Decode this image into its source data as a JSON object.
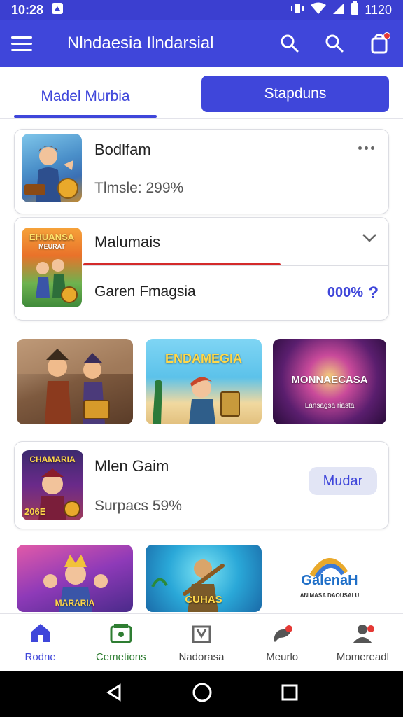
{
  "status_bar": {
    "time": "10:28",
    "right_time": "1120"
  },
  "app_bar": {
    "title": "Nlndaesia Ilndarsial"
  },
  "tabs": {
    "left": "Madel Murbia",
    "right": "Stapduns"
  },
  "cards": [
    {
      "title": "Bodlfam",
      "subtitle": "Tlmsle: 299%"
    },
    {
      "title": "Malumais",
      "subtitle": "Garen Fmagsia",
      "percent": "000%",
      "progress": 0.67
    },
    {
      "title": "Mlen Gaim",
      "subtitle": "Surpacs 59%",
      "button": "Mudar"
    }
  ],
  "thumb_texts": {
    "card1": "",
    "card2_top": "EHUANSA",
    "card2_sub": "MEURAT",
    "card3_top": "CHAMARIA",
    "card3_bottom": "206E"
  },
  "tiles_row1": [
    {
      "label": ""
    },
    {
      "label": "ENDAMEGIA"
    },
    {
      "label": "MONNAECASA",
      "sub": "Lansagsa riasta"
    }
  ],
  "tiles_row2": [
    {
      "label": "MARARIA"
    },
    {
      "label": "CUHAS"
    },
    {
      "label": "GalenaH",
      "sub": "ANIMASA DAOUSALU"
    }
  ],
  "bottom_nav": [
    {
      "label": "Rodne",
      "icon": "home-icon"
    },
    {
      "label": "Cemetions",
      "icon": "wallet-icon"
    },
    {
      "label": "Nadorasa",
      "icon": "box-icon"
    },
    {
      "label": "Meurlo",
      "icon": "chat-icon"
    },
    {
      "label": "Momereadl",
      "icon": "person-icon"
    }
  ],
  "colors": {
    "primary": "#3f46da",
    "badge": "#e53935",
    "progress": "#d42a2a"
  }
}
